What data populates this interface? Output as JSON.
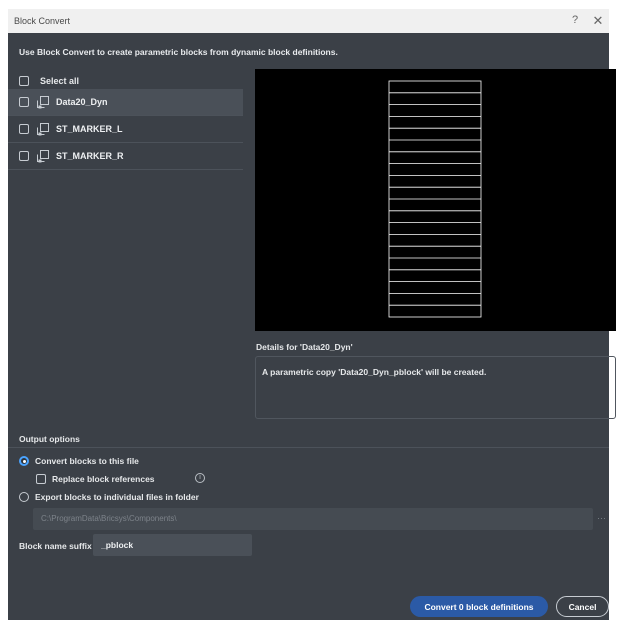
{
  "window": {
    "title": "Block Convert",
    "help_glyph": "?",
    "close_glyph": "✕"
  },
  "intro": "Use Block Convert to create parametric blocks from dynamic block definitions.",
  "select_all": {
    "label": "Select all",
    "checked": false
  },
  "blocks": [
    {
      "name": "Data20_Dyn",
      "selected": true,
      "checked": false,
      "icon": "block-icon"
    },
    {
      "name": "ST_MARKER_L",
      "selected": false,
      "checked": false,
      "icon": "block-icon"
    },
    {
      "name": "ST_MARKER_R",
      "selected": false,
      "checked": false,
      "icon": "block-icon"
    }
  ],
  "details": {
    "label": "Details for 'Data20_Dyn'",
    "text": "A parametric copy 'Data20_Dyn_pblock' will be created."
  },
  "output": {
    "label": "Output options",
    "convert_label": "Convert blocks to this file",
    "convert_selected": true,
    "replace_label": "Replace block references",
    "replace_checked": false,
    "info_glyph": "i",
    "export_label": "Export blocks to individual files in folder",
    "export_selected": false,
    "folder_path": "C:\\ProgramData\\Bricsys\\Components\\",
    "browse_glyph": "···"
  },
  "suffix": {
    "label": "Block name suffix",
    "value": "_pblock"
  },
  "buttons": {
    "convert": "Convert 0 block definitions",
    "cancel": "Cancel"
  },
  "colors": {
    "accent": "#4aa3ff",
    "primary_button": "#2b5aa6",
    "dialog_bg": "#3b4047",
    "preview_bg": "#000000"
  }
}
